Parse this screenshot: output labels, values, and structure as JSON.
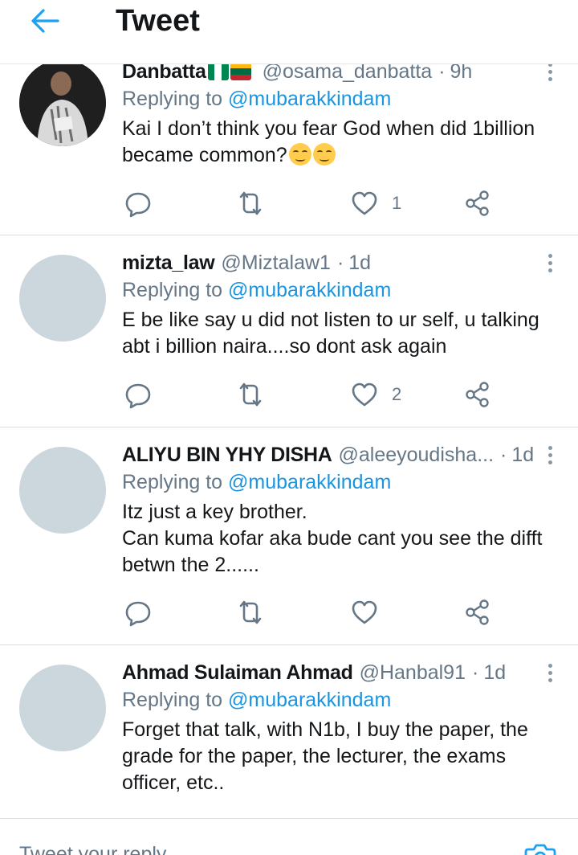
{
  "header": {
    "title": "Tweet"
  },
  "tweets": [
    {
      "name": "Danbatta",
      "handle": "@osama_danbatta",
      "time": "9h",
      "replying_prefix": "Replying to ",
      "mention": "@mubarakkindam",
      "text_parts": [
        "Kai I don’t think you fear God when did 1billion became common?"
      ],
      "likes": "1"
    },
    {
      "name": "mizta_law",
      "handle": "@Miztalaw1",
      "time": "1d",
      "replying_prefix": "Replying to ",
      "mention": "@mubarakkindam",
      "text": "E be like say u did not listen to ur self, u talking abt i billion naira....so dont ask again",
      "likes": "2"
    },
    {
      "name": "ALIYU BIN YHY DISHA",
      "handle": "@aleeyoudisha...",
      "time": "1d",
      "replying_prefix": "Replying to ",
      "mention": "@mubarakkindam",
      "text": "Itz just a key brother.\nCan kuma kofar aka bude cant you see the difft betwn the 2......",
      "likes": ""
    },
    {
      "name": "Ahmad Sulaiman Ahmad",
      "handle": "@Hanbal91",
      "time": "1d",
      "replying_prefix": "Replying to ",
      "mention": "@mubarakkindam",
      "text": "Forget that talk, with N1b, I buy the paper, the grade for the paper, the lecturer, the exams officer, etc.."
    }
  ],
  "bottom": {
    "reply_placeholder": "Tweet your reply"
  },
  "icons": {
    "back": "back-arrow-icon",
    "reply": "reply-icon",
    "retweet": "retweet-icon",
    "like": "heart-icon",
    "share": "share-icon",
    "more": "more-vertical-icon",
    "camera": "camera-icon"
  },
  "colors": {
    "accent": "#1da1f2",
    "mention": "#1b95e0",
    "muted": "#657786",
    "avatar_placeholder": "#ccd6dd"
  }
}
